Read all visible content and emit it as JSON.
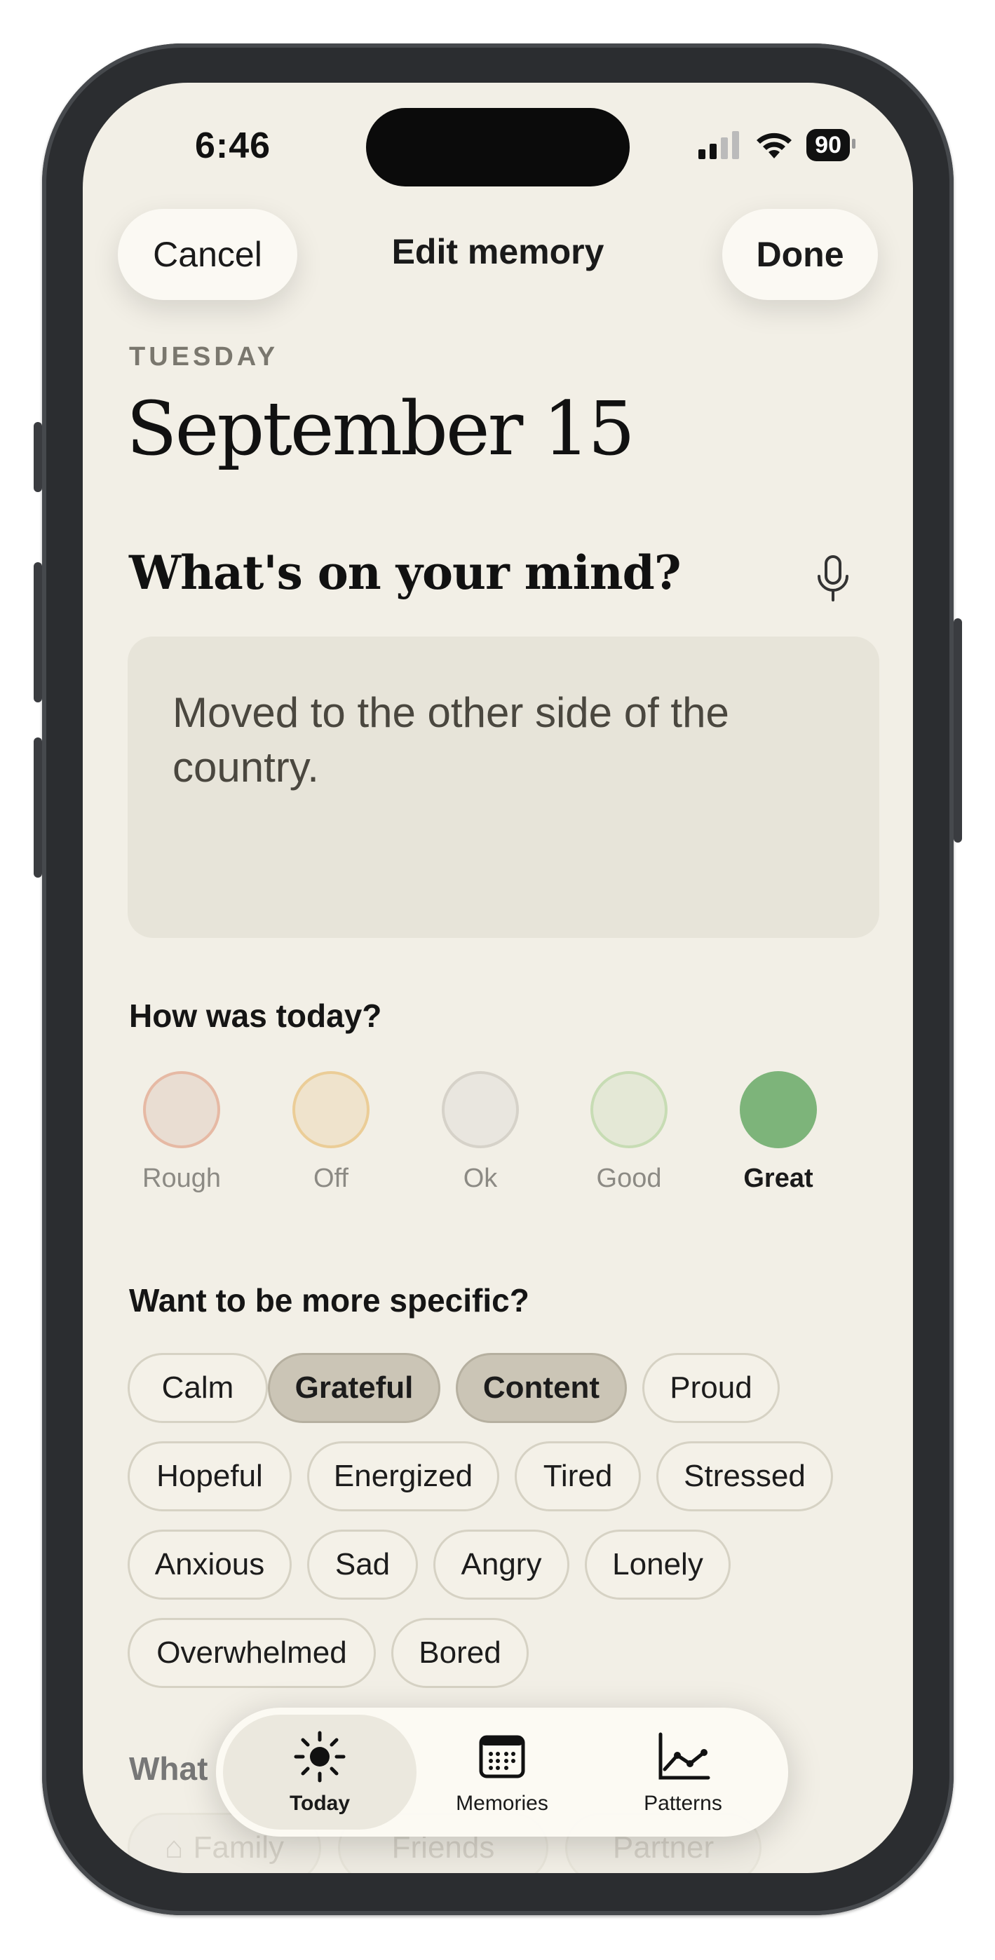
{
  "status_bar": {
    "time": "6:46",
    "battery": "90"
  },
  "nav": {
    "cancel_label": "Cancel",
    "title": "Edit memory",
    "done_label": "Done"
  },
  "entry": {
    "weekday": "TUESDAY",
    "date": "September 15",
    "prompt": "What's on your mind?",
    "text": "Moved to the other side of the country."
  },
  "mood": {
    "heading": "How was today?",
    "options": [
      {
        "label": "Rough",
        "color": "#e9ddd2",
        "border": "#e6b9a4"
      },
      {
        "label": "Off",
        "color": "#efe3cc",
        "border": "#ebcd97"
      },
      {
        "label": "Ok",
        "color": "#e9e6df",
        "border": "#d6d2c9"
      },
      {
        "label": "Good",
        "color": "#e4e8d6",
        "border": "#c7dcb4"
      },
      {
        "label": "Great",
        "color": "#7db47a",
        "border": "#7db47a"
      }
    ],
    "selected": "Great"
  },
  "emotions": {
    "heading": "Want to be more specific?",
    "chips": [
      "Calm",
      "Grateful",
      "Content",
      "Proud",
      "Hopeful",
      "Energized",
      "Tired",
      "Stressed",
      "Anxious",
      "Sad",
      "Angry",
      "Lonely",
      "Overwhelmed",
      "Bored"
    ],
    "selected": [
      "Grateful",
      "Content"
    ]
  },
  "people": {
    "heading": "What",
    "chips": [
      "Family",
      "Friends",
      "Partner"
    ]
  },
  "tabs": [
    {
      "label": "Today",
      "icon": "sun-icon",
      "active": true
    },
    {
      "label": "Memories",
      "icon": "calendar-icon",
      "active": false
    },
    {
      "label": "Patterns",
      "icon": "chart-line-icon",
      "active": false
    }
  ]
}
